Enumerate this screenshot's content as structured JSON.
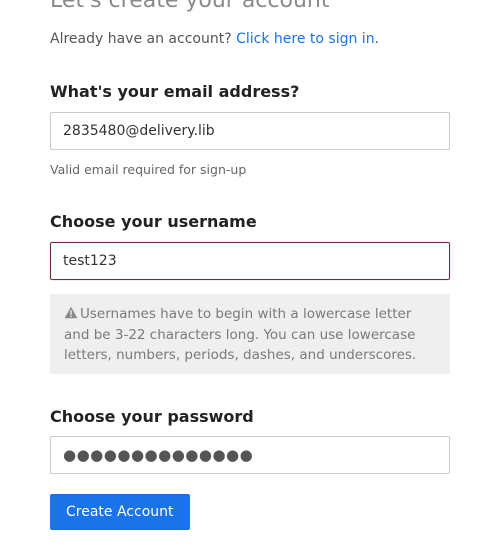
{
  "header": {
    "title": "Let's create your account"
  },
  "signin": {
    "prompt": "Already have an account?",
    "link_label": "Click here to sign in",
    "trailing": "."
  },
  "email": {
    "label": "What's your email address?",
    "value": "2835480@delivery.lib",
    "help": "Valid email required for sign-up"
  },
  "username": {
    "label": "Choose your username",
    "value": "test123",
    "notice": "Usernames have to begin with a lowercase letter and be 3-22 characters long. You can use lowercase letters, numbers, periods, dashes, and underscores."
  },
  "password": {
    "label": "Choose your password",
    "masked_value": "●●●●●●●●●●●●●●"
  },
  "actions": {
    "submit_label": "Create Account"
  },
  "colors": {
    "accent": "#1a73e8",
    "focused_border": "#7a2a3a",
    "notice_background": "#efefef"
  },
  "icons": {
    "notice_icon": "warning-triangle-icon"
  }
}
